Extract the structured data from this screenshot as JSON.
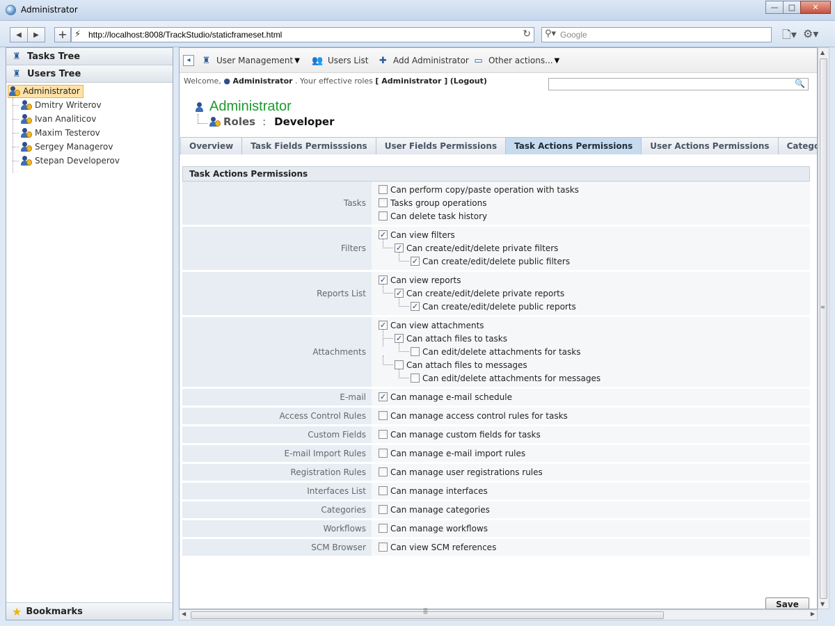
{
  "window": {
    "title": "Administrator",
    "minimize": "—",
    "maximize": "□",
    "close": "✕"
  },
  "browser": {
    "back": "◀",
    "forward": "▶",
    "add": "+",
    "url": "http://localhost:8008/TrackStudio/staticframeset.html",
    "search_placeholder": "Google"
  },
  "sidebar": {
    "tasks_tree": "Tasks Tree",
    "users_tree": "Users Tree",
    "selected_user": "Administrator",
    "users": [
      "Dmitry Writerov",
      "Ivan Analiticov",
      "Maxim Testerov",
      "Sergey Managerov",
      "Stepan Developerov"
    ],
    "bookmarks": "Bookmarks"
  },
  "toolbar": {
    "user_management": "User Management",
    "users_list": "Users List",
    "add_administrator": "Add Administrator",
    "other_actions": "Other actions..."
  },
  "welcome": {
    "prefix": "Welcome,",
    "user": "Administrator",
    "roles_text": ". Your effective roles",
    "roles": "[ Administrator ]",
    "logout": "(Logout)"
  },
  "header": {
    "name": "Administrator",
    "roles_label": "Roles",
    "colon": ":",
    "role": "Developer"
  },
  "tabs": [
    {
      "label": "Overview",
      "active": false
    },
    {
      "label": "Task Fields Permisssions",
      "active": false
    },
    {
      "label": "User Fields Permissions",
      "active": false
    },
    {
      "label": "Task Actions Permissions",
      "active": true
    },
    {
      "label": "User Actions Permissions",
      "active": false
    },
    {
      "label": "Categories",
      "active": false
    }
  ],
  "panel": {
    "title": "Task Actions Permissions",
    "groups": [
      {
        "label": "Tasks",
        "items": [
          {
            "text": "Can perform copy/paste operation with tasks",
            "checked": false,
            "level": 0
          },
          {
            "text": "Tasks group operations",
            "checked": false,
            "level": 0
          },
          {
            "text": "Can delete task history",
            "checked": false,
            "level": 0
          }
        ]
      },
      {
        "label": "Filters",
        "items": [
          {
            "text": "Can view filters",
            "checked": true,
            "level": 0
          },
          {
            "text": "Can create/edit/delete private filters",
            "checked": true,
            "level": 1
          },
          {
            "text": "Can create/edit/delete public filters",
            "checked": true,
            "level": 2
          }
        ]
      },
      {
        "label": "Reports List",
        "items": [
          {
            "text": "Can view reports",
            "checked": true,
            "level": 0
          },
          {
            "text": "Can create/edit/delete private reports",
            "checked": true,
            "level": 1
          },
          {
            "text": "Can create/edit/delete public reports",
            "checked": true,
            "level": 2
          }
        ]
      },
      {
        "label": "Attachments",
        "items": [
          {
            "text": "Can view attachments",
            "checked": true,
            "level": 0
          },
          {
            "text": "Can attach files to tasks",
            "checked": true,
            "level": 1,
            "cont": true
          },
          {
            "text": "Can edit/delete attachments for tasks",
            "checked": false,
            "level": 2
          },
          {
            "text": "Can attach files to messages",
            "checked": false,
            "level": 1
          },
          {
            "text": "Can edit/delete attachments for messages",
            "checked": false,
            "level": 2
          }
        ]
      },
      {
        "label": "E-mail",
        "items": [
          {
            "text": "Can manage e-mail schedule",
            "checked": true,
            "level": 0
          }
        ]
      },
      {
        "label": "Access Control Rules",
        "items": [
          {
            "text": "Can manage access control rules for tasks",
            "checked": false,
            "level": 0
          }
        ]
      },
      {
        "label": "Custom Fields",
        "items": [
          {
            "text": "Can manage custom fields for tasks",
            "checked": false,
            "level": 0
          }
        ]
      },
      {
        "label": "E-mail Import Rules",
        "items": [
          {
            "text": "Can manage e-mail import rules",
            "checked": false,
            "level": 0
          }
        ]
      },
      {
        "label": "Registration Rules",
        "items": [
          {
            "text": "Can manage user registrations rules",
            "checked": false,
            "level": 0
          }
        ]
      },
      {
        "label": "Interfaces List",
        "items": [
          {
            "text": "Can manage interfaces",
            "checked": false,
            "level": 0
          }
        ]
      },
      {
        "label": "Categories",
        "items": [
          {
            "text": "Can manage categories",
            "checked": false,
            "level": 0
          }
        ]
      },
      {
        "label": "Workflows",
        "items": [
          {
            "text": "Can manage workflows",
            "checked": false,
            "level": 0
          }
        ]
      },
      {
        "label": "SCM Browser",
        "items": [
          {
            "text": "Can view SCM references",
            "checked": false,
            "level": 0
          }
        ]
      }
    ],
    "save_label": "Save"
  }
}
